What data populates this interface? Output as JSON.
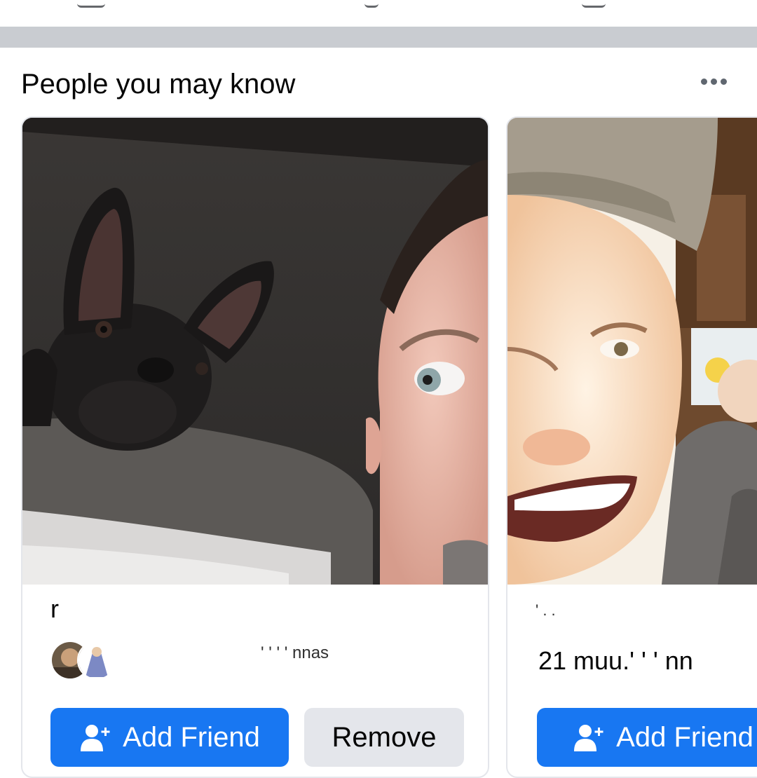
{
  "colors": {
    "primary": "#1877f2",
    "secondary_button": "#e4e6eb",
    "separator": "#c9ccd1",
    "text": "#050505",
    "icon": "#606770"
  },
  "section": {
    "title": "People you may know",
    "menu_icon": "more-horizontal-icon"
  },
  "cards": [
    {
      "name": "r",
      "mutual_friends": "' ' ' ' nnas",
      "photo": "selfie-with-french-bulldog",
      "add_friend_label": "Add Friend",
      "add_friend_icon": "add-user-icon",
      "remove_label": "Remove"
    },
    {
      "name": "' . .",
      "mutual_friends": "21 muu.' ' ' nn",
      "photo": "smiling-man-in-cap",
      "add_friend_label": "Add Friend",
      "add_friend_icon": "add-user-icon"
    }
  ]
}
